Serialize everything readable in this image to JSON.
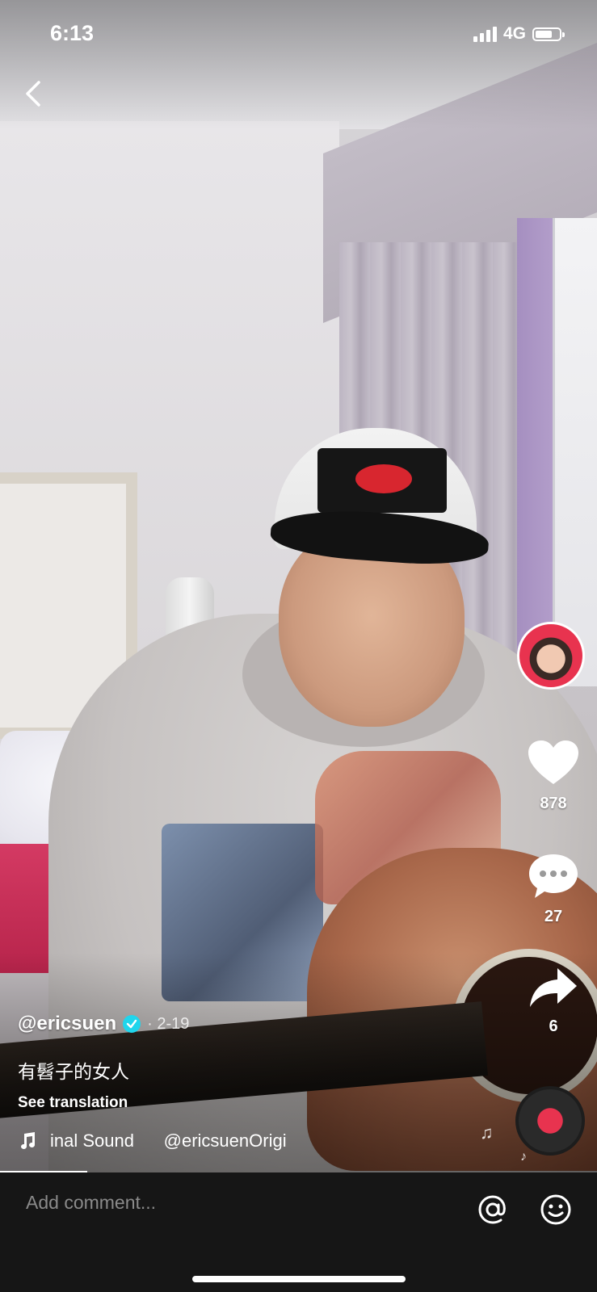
{
  "status_bar": {
    "time": "6:13",
    "network": "4G"
  },
  "video": {
    "author": "@ericsuen",
    "date": "· 2-19",
    "caption": "有髫子的女人",
    "see_translation": "See translation",
    "sound_text": "inal Sound      @ericsuenOrigi"
  },
  "actions": {
    "likes": "878",
    "comments": "27",
    "shares": "6"
  },
  "comment_bar": {
    "placeholder": "Add comment..."
  },
  "icons": [
    "back-icon",
    "like-heart-icon",
    "comment-bubble-icon",
    "share-arrow-icon",
    "music-note-icon",
    "at-icon",
    "emoji-icon",
    "verified-icon"
  ]
}
